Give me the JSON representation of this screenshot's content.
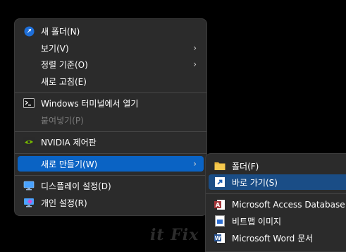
{
  "main_menu": {
    "new_folder": "새 폴더(N)",
    "view": "보기(V)",
    "sort_by": "정렬 기준(O)",
    "refresh": "새로 고침(E)",
    "terminal": "Windows 터미널에서 열기",
    "paste": "붙여넣기(P)",
    "nvidia": "NVIDIA 제어판",
    "new": "새로 만들기(W)",
    "display_settings": "디스플레이 설정(D)",
    "personalize": "개인 설정(R)"
  },
  "sub_menu": {
    "folder": "폴더(F)",
    "shortcut": "바로 가기(S)",
    "access": "Microsoft Access Database",
    "bitmap": "비트맵 이미지",
    "word": "Microsoft Word 문서"
  },
  "watermark": "it Fix",
  "colors": {
    "highlight": "#0a63c4",
    "menu_bg": "#2b2b2b"
  }
}
